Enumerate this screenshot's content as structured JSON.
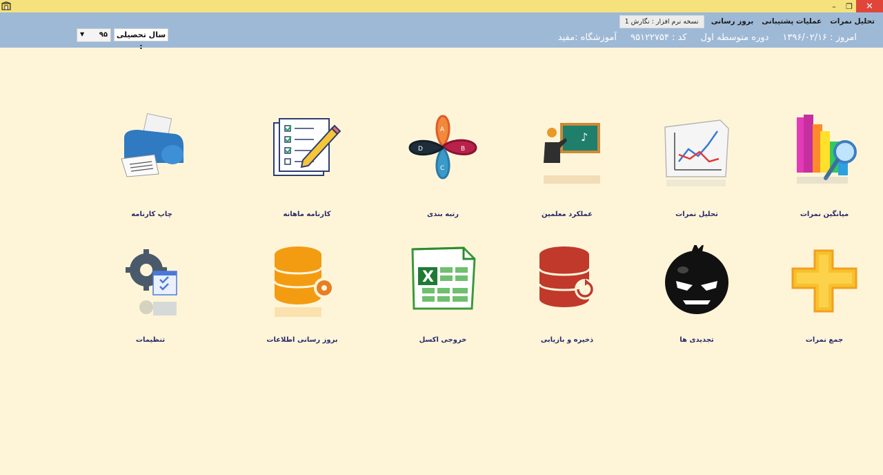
{
  "window": {
    "min_glyph": "–",
    "max_glyph": "❐",
    "close_glyph": "✕"
  },
  "menu": {
    "items": [
      "تحلیل نمرات",
      "عملیات پشتیبانی",
      "بروز رسانی"
    ],
    "version": "نسخه نرم افزار : نگارش 1"
  },
  "header_info": {
    "school": "آموزشگاه :مفید",
    "code": "کد :  ۹۵۱۲۲۷۵۴",
    "level": "دوره متوسطه اول",
    "today": "امروز : ۱۳۹۶/۰۲/۱۶"
  },
  "academic_year": {
    "label": "سال تحصیلی :",
    "value": "۹۵"
  },
  "tiles": [
    {
      "id": "average",
      "label": "میانگین نمرات",
      "icon": "bar-chart-magnifier-icon"
    },
    {
      "id": "analysis",
      "label": "تحلیل نمرات",
      "icon": "line-graph-icon"
    },
    {
      "id": "teachers",
      "label": "عملکرد معلمین",
      "icon": "teacher-board-icon"
    },
    {
      "id": "ranking",
      "label": "رتبه بندی",
      "icon": "abcd-petals-icon"
    },
    {
      "id": "monthly",
      "label": "کارنامه ماهانه",
      "icon": "checklist-pencil-icon"
    },
    {
      "id": "print",
      "label": "چاپ کارنامه",
      "icon": "printer-icon"
    },
    {
      "id": "sum",
      "label": "جمع نمرات",
      "icon": "plus-icon"
    },
    {
      "id": "retakes",
      "label": "تجدیدی ها",
      "icon": "angry-ball-icon"
    },
    {
      "id": "backup",
      "label": "ذخیره و بازیابی",
      "icon": "database-restore-icon"
    },
    {
      "id": "excel",
      "label": "خروجی اکسل",
      "icon": "excel-icon"
    },
    {
      "id": "update",
      "label": "بروز رسانی اطلاعات",
      "icon": "database-gear-icon"
    },
    {
      "id": "settings",
      "label": "تنظیمات",
      "icon": "gear-checklist-icon"
    }
  ],
  "colors": {
    "background": "#fef5d9",
    "titlebar": "#f5e27c",
    "header": "#9eb9d6",
    "label": "#2a2a68"
  }
}
